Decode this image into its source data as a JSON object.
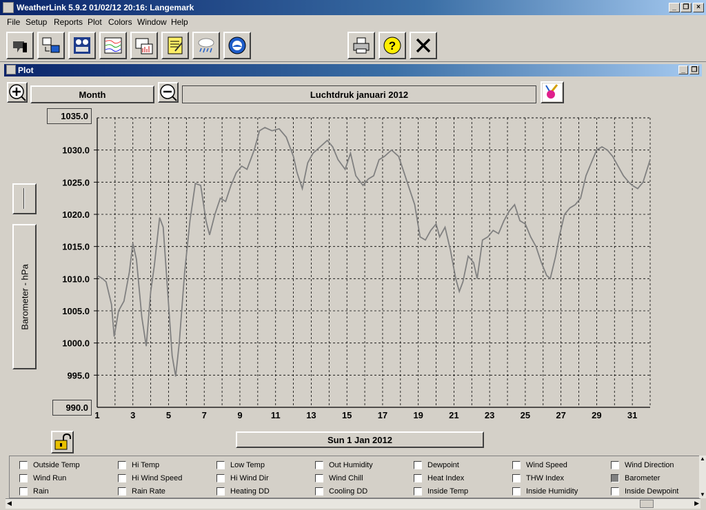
{
  "window": {
    "title": "WeatherLink 5.9.2  01/02/12  20:16: Langemark"
  },
  "menu": [
    "File",
    "Setup",
    "Reports",
    "Plot",
    "Colors",
    "Window",
    "Help"
  ],
  "toolbar": {
    "buttons": [
      "bulletin-icon",
      "transfer-icon",
      "summary-icon",
      "strip-chart-icon",
      "plot-icon",
      "notepad-icon",
      "rain-icon",
      "noaa-icon",
      "print-icon",
      "help-icon",
      "close-icon"
    ]
  },
  "plot_window": {
    "title": "Plot",
    "span_label": "Month",
    "plot_title": "Luchtdruk  januari 2012",
    "y_axis_button": "Barometer - hPa",
    "date_button": "Sun 1 Jan 2012",
    "y_top_box": "1035.0",
    "y_bottom_box": "990.0"
  },
  "chart_data": {
    "type": "line",
    "title": "Luchtdruk  januari 2012",
    "ylabel": "Barometer - hPa",
    "xlabel": "",
    "xlim": [
      1,
      32
    ],
    "ylim": [
      990,
      1035
    ],
    "grid": true,
    "x_ticks": [
      1,
      3,
      5,
      7,
      9,
      11,
      13,
      15,
      17,
      19,
      21,
      23,
      25,
      27,
      29,
      31
    ],
    "y_ticks": [
      "1035.0",
      "1030.0",
      "1025.0",
      "1020.0",
      "1015.0",
      "1010.0",
      "1005.0",
      "1000.0",
      "995.0",
      "990.0"
    ],
    "series": [
      {
        "color": "#808080",
        "x": [
          1.0,
          1.3,
          1.5,
          1.8,
          1.95,
          2.2,
          2.5,
          2.8,
          3.0,
          3.2,
          3.5,
          3.75,
          4.0,
          4.2,
          4.5,
          4.7,
          5.0,
          5.2,
          5.4,
          5.6,
          5.9,
          6.2,
          6.5,
          6.8,
          7.1,
          7.3,
          7.6,
          7.9,
          8.2,
          8.5,
          8.8,
          9.1,
          9.4,
          9.8,
          10.1,
          10.4,
          10.8,
          11.2,
          11.6,
          12.0,
          12.2,
          12.5,
          12.8,
          13.1,
          13.5,
          13.9,
          14.2,
          14.5,
          14.9,
          15.2,
          15.5,
          15.9,
          16.2,
          16.5,
          16.8,
          17.1,
          17.5,
          17.9,
          18.2,
          18.5,
          18.8,
          19.1,
          19.4,
          19.7,
          20.0,
          20.2,
          20.5,
          20.8,
          21.1,
          21.3,
          21.5,
          21.8,
          22.1,
          22.3,
          22.6,
          22.9,
          23.2,
          23.5,
          23.8,
          24.1,
          24.4,
          24.7,
          25.0,
          25.3,
          25.6,
          25.9,
          26.2,
          26.4,
          26.7,
          26.9,
          27.2,
          27.5,
          27.8,
          28.1,
          28.4,
          28.7,
          29.0,
          29.3,
          29.6,
          29.9,
          30.2,
          30.5,
          30.8,
          31.0,
          31.3,
          31.6,
          32.0
        ],
        "y": [
          1010.5,
          1010.0,
          1009.5,
          1006.0,
          1001.0,
          1005.0,
          1006.5,
          1011.0,
          1015.5,
          1013.0,
          1004.0,
          999.5,
          1008.0,
          1012.0,
          1019.5,
          1018.0,
          1006.0,
          998.0,
          994.8,
          1000.0,
          1011.0,
          1019.0,
          1024.8,
          1024.5,
          1019.0,
          1016.8,
          1020.0,
          1022.5,
          1022.0,
          1024.5,
          1026.5,
          1027.5,
          1027.0,
          1030.0,
          1033.0,
          1033.5,
          1033.0,
          1033.3,
          1032.0,
          1029.0,
          1026.5,
          1024.0,
          1028.0,
          1029.5,
          1030.5,
          1031.5,
          1030.5,
          1028.5,
          1027.0,
          1029.5,
          1026.0,
          1024.5,
          1025.5,
          1026.0,
          1028.5,
          1029.0,
          1030.0,
          1029.0,
          1026.5,
          1024.0,
          1021.5,
          1016.5,
          1016.0,
          1017.5,
          1018.5,
          1016.5,
          1018.0,
          1014.5,
          1010.0,
          1008.0,
          1009.5,
          1013.5,
          1012.5,
          1010.0,
          1016.0,
          1016.5,
          1017.5,
          1017.0,
          1019.0,
          1020.5,
          1021.5,
          1019.0,
          1018.5,
          1016.5,
          1015.0,
          1012.5,
          1010.5,
          1010.0,
          1013.5,
          1016.5,
          1020.0,
          1021.0,
          1021.5,
          1022.5,
          1026.0,
          1028.0,
          1030.0,
          1030.5,
          1030.0,
          1029.0,
          1027.5,
          1026.0,
          1025.0,
          1024.5,
          1024.0,
          1025.0,
          1028.5
        ]
      }
    ]
  },
  "legend": {
    "items": [
      {
        "label": "Outside Temp",
        "checked": false
      },
      {
        "label": "Hi Temp",
        "checked": false
      },
      {
        "label": "Low Temp",
        "checked": false
      },
      {
        "label": "Out Humidity",
        "checked": false
      },
      {
        "label": "Dewpoint",
        "checked": false
      },
      {
        "label": "Wind Speed",
        "checked": false
      },
      {
        "label": "Wind Direction",
        "checked": false
      },
      {
        "label": "Wind Run",
        "checked": false
      },
      {
        "label": "Hi Wind Speed",
        "checked": false
      },
      {
        "label": "Hi Wind Dir",
        "checked": false
      },
      {
        "label": "Wind Chill",
        "checked": false
      },
      {
        "label": "Heat Index",
        "checked": false
      },
      {
        "label": "THW Index",
        "checked": false
      },
      {
        "label": "Barometer",
        "checked": true
      },
      {
        "label": "Rain",
        "checked": false
      },
      {
        "label": "Rain Rate",
        "checked": false
      },
      {
        "label": "Heating DD",
        "checked": false
      },
      {
        "label": "Cooling DD",
        "checked": false
      },
      {
        "label": "Inside Temp",
        "checked": false
      },
      {
        "label": "Inside Humidity",
        "checked": false
      },
      {
        "label": "Inside Dewpoint",
        "checked": false
      }
    ]
  }
}
